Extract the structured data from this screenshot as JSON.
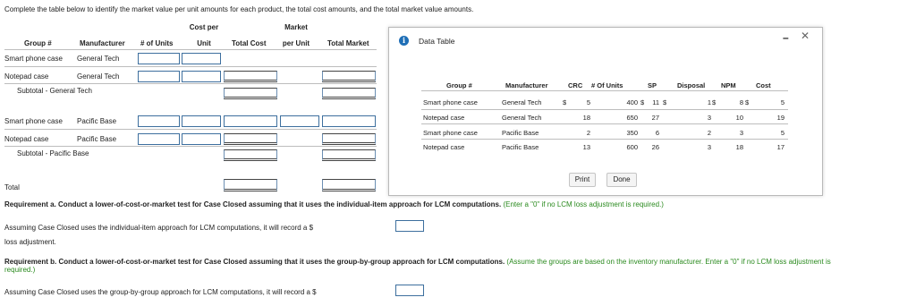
{
  "instructions": "Complete the table below to identify the market value per unit amounts for each product, the total cost amounts, and the total market value amounts.",
  "main_table": {
    "headers": {
      "group": "Group #",
      "manufacturer": "Manufacturer",
      "units": "# of Units",
      "cost_per_top": "Cost per",
      "cost_per_bottom": "Unit",
      "total_cost": "Total Cost",
      "market_top": "Market",
      "market_bottom": "per Unit",
      "total_market": "Total Market"
    },
    "rows": [
      {
        "group": "Smart phone case",
        "manufacturer": "General Tech"
      },
      {
        "group": "Notepad case",
        "manufacturer": "General Tech"
      },
      {
        "subtotal": "Subtotal - General Tech"
      },
      {
        "group": "Smart phone case",
        "manufacturer": "Pacific Base"
      },
      {
        "group": "Notepad case",
        "manufacturer": "Pacific Base"
      },
      {
        "subtotal": "Subtotal - Pacific Base"
      }
    ],
    "total_label": "Total"
  },
  "requirement_a": {
    "label": "Requirement a.",
    "text": "Conduct a lower-of-cost-or-market test for Case Closed assuming that it uses the individual-item approach for LCM computations.",
    "hint": "(Enter a \"0\" if no LCM loss adjustment is required.)",
    "answer_line1": "Assuming Case Closed uses the individual-item approach for LCM computations, it will record a $",
    "answer_line2": "loss adjustment."
  },
  "requirement_b": {
    "label": "Requirement b.",
    "text": "Conduct a lower-of-cost-or-market test for Case Closed assuming that it uses the group-by-group approach for LCM computations.",
    "hint_line1": "(Assume the groups are based on the inventory manufacturer. Enter a \"0\" if no LCM loss adjustment is",
    "hint_line2": "required.)",
    "answer_line": "Assuming Case Closed uses the group-by-group approach for LCM computations, it will record a $"
  },
  "modal": {
    "title": "Data Table",
    "minimize_glyph": "–",
    "close_glyph": "✕",
    "headers": [
      "Group #",
      "Manufacturer",
      "CRC",
      "# Of Units",
      "SP",
      "Disposal",
      "NPM",
      "Cost"
    ],
    "rows": [
      {
        "group": "Smart phone case",
        "manufacturer": "General Tech",
        "crc_sym": "$",
        "crc": "5",
        "units": "400",
        "sp_sym": "$",
        "sp": "11",
        "disp_sym": "$",
        "disposal": "1",
        "npm_sym": "$",
        "npm": "8",
        "cost_sym": "$",
        "cost": "5"
      },
      {
        "group": "Notepad case",
        "manufacturer": "General Tech",
        "crc_sym": "",
        "crc": "18",
        "units": "650",
        "sp_sym": "",
        "sp": "27",
        "disp_sym": "",
        "disposal": "3",
        "npm_sym": "",
        "npm": "10",
        "cost_sym": "",
        "cost": "19"
      },
      {
        "group": "Smart phone case",
        "manufacturer": "Pacific Base",
        "crc_sym": "",
        "crc": "2",
        "units": "350",
        "sp_sym": "",
        "sp": "6",
        "disp_sym": "",
        "disposal": "2",
        "npm_sym": "",
        "npm": "3",
        "cost_sym": "",
        "cost": "5"
      },
      {
        "group": "Notepad case",
        "manufacturer": "Pacific Base",
        "crc_sym": "",
        "crc": "13",
        "units": "600",
        "sp_sym": "",
        "sp": "26",
        "disp_sym": "",
        "disposal": "3",
        "npm_sym": "",
        "npm": "18",
        "cost_sym": "",
        "cost": "17"
      }
    ],
    "print_label": "Print",
    "done_label": "Done"
  }
}
